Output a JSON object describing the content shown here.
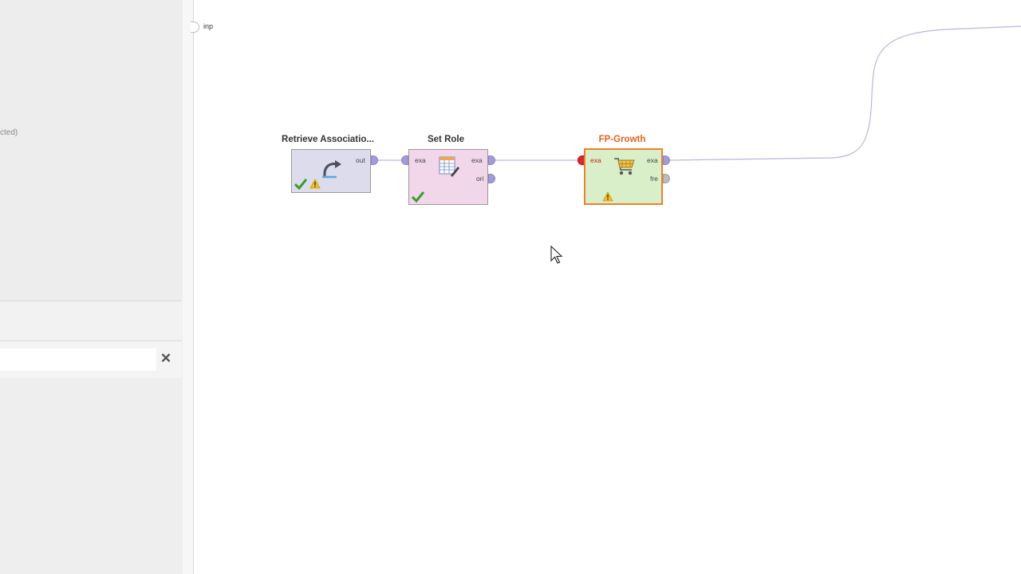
{
  "sidebar": {
    "truncated_text": "cted)",
    "search": {
      "value": "",
      "placeholder": ""
    }
  },
  "canvas": {
    "input_port_label": "inp",
    "operators": [
      {
        "name": "Retrieve Associatio...",
        "ports_out": [
          "out"
        ],
        "status": "ok-with-warning",
        "color": "#dcdcec"
      },
      {
        "name": "Set Role",
        "ports_in": [
          "exa"
        ],
        "ports_out": [
          "exa",
          "ori"
        ],
        "status": "ok",
        "color": "#f2d6ea"
      },
      {
        "name": "FP-Growth",
        "ports_in": [
          "exa"
        ],
        "ports_out": [
          "exa",
          "fre"
        ],
        "status": "warning",
        "color": "#d9efc9",
        "title_color": "#e2641e",
        "selected": true
      }
    ]
  },
  "colors": {
    "wire": "#b9b6dd",
    "selection": "#f07f2c",
    "warning": "#f2c21a",
    "check": "#3c9a2c"
  },
  "icons": {
    "retrieve": "curved-arrow-icon",
    "set_role": "table-edit-icon",
    "fp_growth": "shopping-cart-icon",
    "ok": "checkmark-icon",
    "warn": "warning-triangle-icon",
    "close": "close-icon",
    "cursor": "mouse-pointer-icon"
  }
}
